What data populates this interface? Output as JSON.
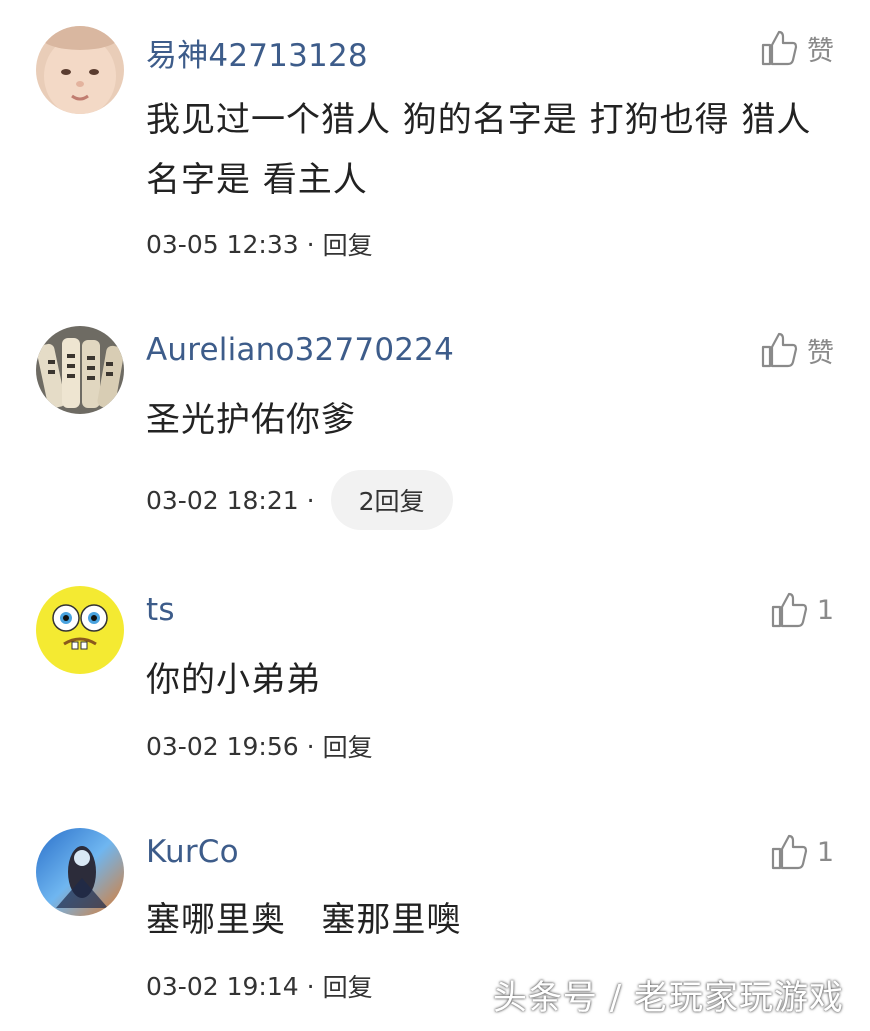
{
  "comments": [
    {
      "username": "易神42713128",
      "like_label": "赞",
      "content": "我见过一个猎人 狗的名字是 打狗也得 猎人名字是 看主人",
      "time": "03-05 12:33",
      "reply_label": "回复"
    },
    {
      "username": "Aureliano32770224",
      "like_label": "赞",
      "content": "圣光护佑你爹",
      "time": "03-02 18:21",
      "reply_label": "2回复"
    },
    {
      "username": "ts",
      "like_label": "1",
      "content": "你的小弟弟",
      "time": "03-02 19:56",
      "reply_label": "回复"
    },
    {
      "username": "KurCo",
      "like_label": "1",
      "content": "塞哪里奥   塞那里噢",
      "time": "03-02 19:14",
      "reply_label": "回复"
    }
  ],
  "separator": "·",
  "watermark": "头条号 / 老玩家玩游戏"
}
